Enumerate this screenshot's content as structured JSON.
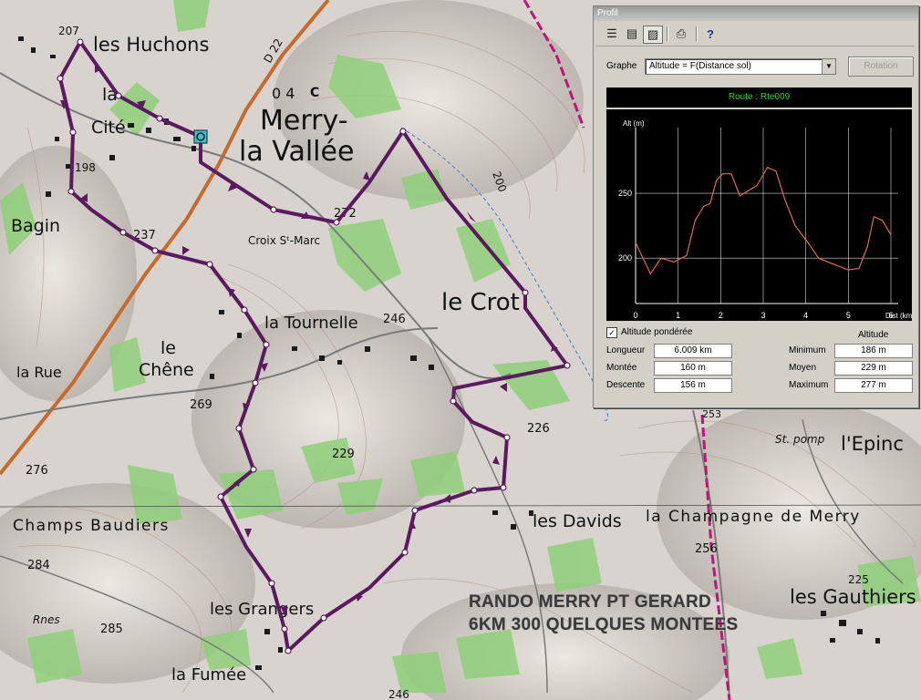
{
  "map": {
    "place_labels": [
      "les Huchons",
      "D 22",
      "0 4",
      "C",
      "Merry-",
      "la Vallée",
      "la",
      "Cité",
      "Bagin",
      "237",
      "272",
      "Croix Sᵗ-Marc",
      "le Crot",
      "la Tournelle",
      "246",
      "le",
      "Chêne",
      "la Rue",
      "269",
      "229",
      "226",
      "276",
      "Champs Baudiers",
      "les Davids",
      "la Champagne de Merry",
      "256",
      "284",
      "285",
      "les Grangers",
      "la Fumée",
      "les Gauthiers",
      "l'Epinc",
      "St. pomp",
      "225",
      "200",
      "253",
      "207",
      "198",
      "Rnes",
      "246"
    ]
  },
  "caption": {
    "line1": "RANDO MERRY PT GERARD",
    "line2": "6KM 300 QUELQUES MONTEES"
  },
  "profile": {
    "title": "Profil",
    "toolbar_icons": [
      "list-icon",
      "properties-icon",
      "chart-icon",
      "print-icon",
      "help-icon"
    ],
    "graph_label": "Graphe",
    "graph_value": "Altitude = F(Distance sol)",
    "rotation_label": "Rotation",
    "route_label": "Route : Rte009",
    "weighted_label": "Altitude pondérée",
    "weighted_checked": "✓",
    "altitude_header": "Altitude",
    "stats": {
      "length_label": "Longueur",
      "length_value": "6.009 km",
      "ascent_label": "Montée",
      "ascent_value": "160 m",
      "descent_label": "Descente",
      "descent_value": "156 m",
      "min_label": "Minimum",
      "min_value": "186 m",
      "mean_label": "Moyen",
      "mean_value": "229 m",
      "max_label": "Maximum",
      "max_value": "277 m"
    },
    "colors": {
      "route_text": "#2bd12b",
      "profile_line": "#e06a50",
      "grid": "#ffffff"
    }
  },
  "chart_data": {
    "type": "line",
    "ylabel": "Alt (m)",
    "xlabel": "Dist (km)",
    "xlim": [
      0,
      6
    ],
    "ylim": [
      165,
      295
    ],
    "x_ticks": [
      "0",
      "1",
      "2",
      "3",
      "4",
      "5",
      "6"
    ],
    "y_ticks": [
      "200",
      "250"
    ],
    "grid": true,
    "series": [
      {
        "x": [
          0,
          0.35,
          0.6,
          0.9,
          1.2,
          1.4,
          1.6,
          1.75,
          1.9,
          2.05,
          2.25,
          2.45,
          2.6,
          2.85,
          3.1,
          3.3,
          3.5,
          3.75,
          4.05,
          4.3,
          4.6,
          5.0,
          5.25,
          5.45,
          5.6,
          5.8,
          6.0
        ],
        "y": [
          212,
          188,
          200,
          197,
          202,
          229,
          240,
          242,
          260,
          265,
          265,
          248,
          251,
          256,
          270,
          267,
          246,
          225,
          212,
          200,
          196,
          191,
          192,
          209,
          232,
          229,
          218
        ]
      }
    ]
  }
}
